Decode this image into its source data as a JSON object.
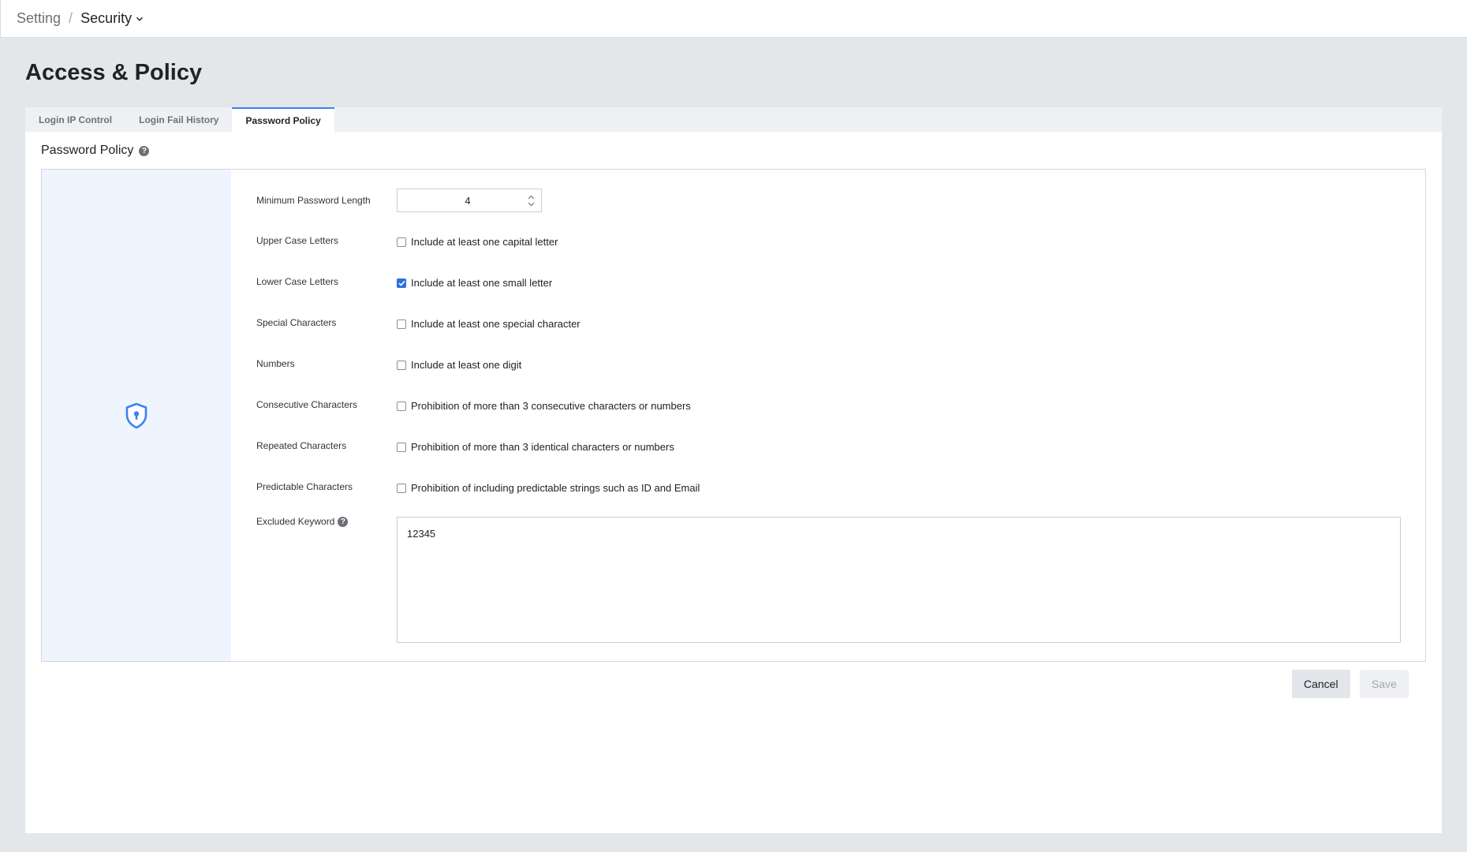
{
  "breadcrumb": {
    "root": "Setting",
    "separator": "/",
    "current": "Security"
  },
  "page": {
    "title": "Access & Policy"
  },
  "tabs": [
    {
      "label": "Login IP Control",
      "active": false
    },
    {
      "label": "Login Fail History",
      "active": false
    },
    {
      "label": "Password Policy",
      "active": true
    }
  ],
  "section": {
    "title": "Password Policy",
    "help_icon": "question-circle-icon"
  },
  "side": {
    "icon": "shield-lock-icon",
    "accent": "#3b82f6",
    "background": "#eef5fe"
  },
  "form": {
    "min_length": {
      "label": "Minimum Password Length",
      "value": "4"
    },
    "upper_case": {
      "label": "Upper Case Letters",
      "text": "Include at least one capital letter",
      "checked": false
    },
    "lower_case": {
      "label": "Lower Case Letters",
      "text": "Include at least one small letter",
      "checked": true
    },
    "special_chars": {
      "label": "Special Characters",
      "text": "Include at least one special character",
      "checked": false
    },
    "numbers": {
      "label": "Numbers",
      "text": "Include at least one digit",
      "checked": false
    },
    "consecutive": {
      "label": "Consecutive Characters",
      "text": "Prohibition of more than 3 consecutive characters or numbers",
      "checked": false
    },
    "repeated": {
      "label": "Repeated Characters",
      "text": "Prohibition of more than 3 identical characters or numbers",
      "checked": false
    },
    "predictable": {
      "label": "Predictable Characters",
      "text": "Prohibition of including predictable strings such as ID and Email",
      "checked": false
    },
    "excluded_keyword": {
      "label": "Excluded Keyword",
      "value": "12345"
    }
  },
  "actions": {
    "cancel_label": "Cancel",
    "save_label": "Save"
  },
  "colors": {
    "checkbox_checked": "#2f6fe0",
    "tab_active_border": "#3b82f6",
    "page_background": "#e4e7ea"
  }
}
